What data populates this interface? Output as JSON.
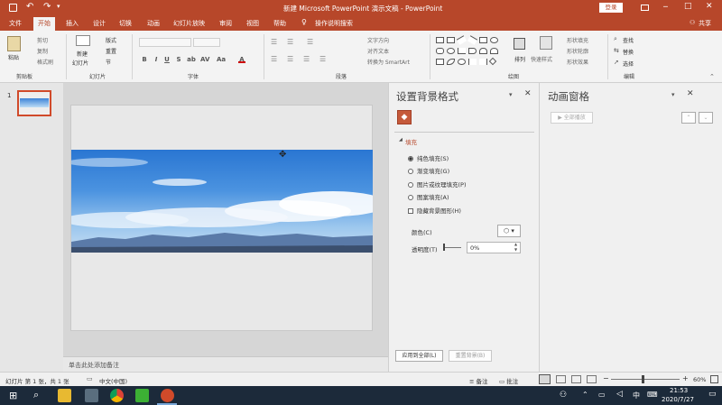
{
  "window": {
    "title": "新建 Microsoft PowerPoint 演示文稿 - PowerPoint",
    "login_label": "登录",
    "share_label": "共享",
    "controls": [
      "─",
      "□",
      "✕"
    ]
  },
  "quick_access": {
    "save_icon": "save-icon",
    "undo_icon": "undo-icon",
    "redo_icon": "redo-icon"
  },
  "tabs": [
    "文件",
    "开始",
    "插入",
    "设计",
    "切换",
    "动画",
    "幻灯片放映",
    "审阅",
    "视图",
    "帮助",
    "操作说明搜索"
  ],
  "active_tab": "开始",
  "ribbon": {
    "clipboard": {
      "paste": "粘贴",
      "cut": "剪切",
      "copy": "复制",
      "format_painter": "格式刷",
      "label": "剪贴板"
    },
    "slides": {
      "new_slide": "新建",
      "new_slide2": "幻灯片",
      "layout": "版式",
      "reset": "重置",
      "section": "节",
      "label": "幻灯片"
    },
    "font": {
      "label": "字体",
      "buttons": [
        "B",
        "I",
        "U",
        "S",
        "ab",
        "AV",
        "Aa",
        "A"
      ]
    },
    "paragraph": {
      "label": "段落",
      "text_direction": "文字方向",
      "align_text": "对齐文本",
      "smartart": "转换为 SmartArt"
    },
    "drawing": {
      "label": "绘图",
      "arrange": "排列",
      "quick_styles": "快速样式",
      "shape_fill": "形状填充",
      "shape_outline": "形状轮廓",
      "shape_effects": "形状效果"
    },
    "editing": {
      "label": "编辑",
      "find": "查找",
      "replace": "替换",
      "select": "选择"
    }
  },
  "thumbnails": [
    {
      "number": "1"
    }
  ],
  "notes_placeholder": "单击此处添加备注",
  "bg_pane": {
    "title": "设置背景格式",
    "section": "填充",
    "options": [
      {
        "label": "纯色填充(S)",
        "selected": true
      },
      {
        "label": "渐变填充(G)",
        "selected": false
      },
      {
        "label": "图片或纹理填充(P)",
        "selected": false
      },
      {
        "label": "图案填充(A)",
        "selected": false
      }
    ],
    "hide_bg_graphics": "隐藏背景图形(H)",
    "color_label": "颜色(C)",
    "transparency_label": "透明度(T)",
    "transparency_value": "0%",
    "apply_all": "应用到全部(L)",
    "reset_bg": "重置背景(B)"
  },
  "anim_pane": {
    "title": "动画窗格",
    "play_all": "全部播放"
  },
  "status": {
    "slide_info": "幻灯片 第 1 张，共 1 张",
    "language": "中文(中国)",
    "notes": "备注",
    "comments": "批注",
    "zoom": "60%"
  },
  "taskbar": {
    "time": "21:53",
    "date": "2020/7/27",
    "ime": "中"
  },
  "colors": {
    "accent": "#b7472a",
    "taskbar": "#1c2a3a",
    "sky_top": "#2f7fd6",
    "sky_bottom": "#9cc8ef"
  }
}
